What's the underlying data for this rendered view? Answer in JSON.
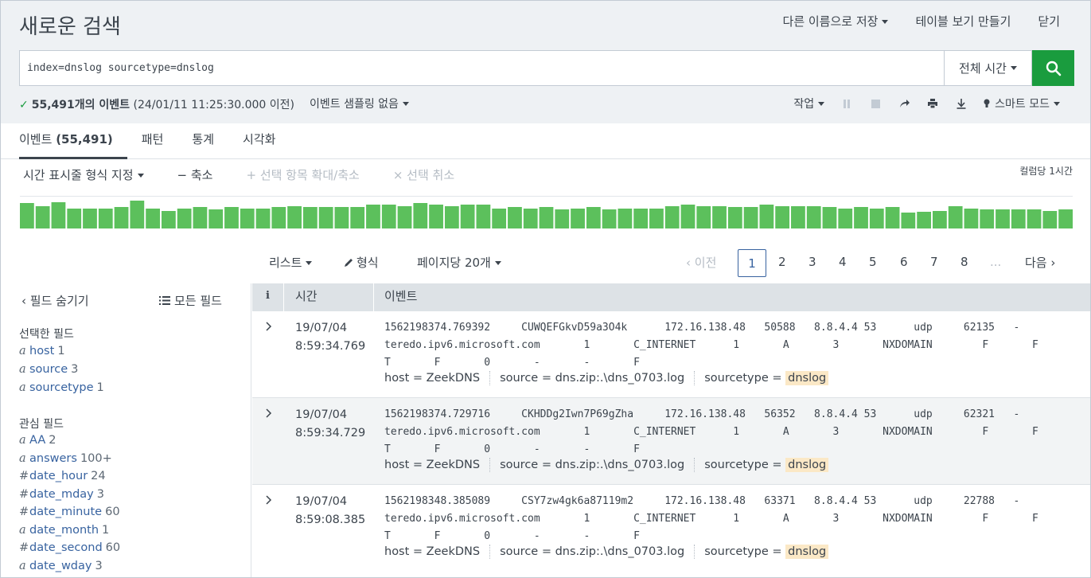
{
  "header": {
    "title": "새로운 검색",
    "save_as": "다른 이름으로 저장",
    "make_table": "테이블 보기 만들기",
    "close": "닫기"
  },
  "search": {
    "query": "index=dnslog sourcetype=dnslog",
    "time_range": "전체 시간"
  },
  "status": {
    "count_text": "55,491개의 이벤트",
    "time_text": "(24/01/11 11:25:30.000 이전)",
    "sampling": "이벤트 샘플링 없음",
    "job": "작업",
    "mode": "스마트 모드"
  },
  "tabs": [
    {
      "label": "이벤트",
      "count": "(55,491)"
    },
    {
      "label": "패턴"
    },
    {
      "label": "통계"
    },
    {
      "label": "시각화"
    }
  ],
  "timeline_tools": {
    "format": "시간 표시줄 형식 지정",
    "zoom_out": "축소",
    "zoom_sel": "선택 항목 확대/축소",
    "deselect": "선택 취소",
    "per_column": "컬럼당 1시간"
  },
  "timeline_bars": [
    32,
    28,
    33,
    25,
    25,
    25,
    27,
    35,
    25,
    22,
    25,
    27,
    24,
    27,
    25,
    25,
    27,
    28,
    27,
    27,
    27,
    27,
    30,
    30,
    28,
    32,
    30,
    28,
    30,
    30,
    25,
    27,
    25,
    27,
    24,
    25,
    27,
    24,
    25,
    25,
    25,
    28,
    30,
    28,
    28,
    27,
    27,
    30,
    28,
    28,
    28,
    27,
    25,
    27,
    25,
    27,
    20,
    21,
    22,
    28,
    25,
    24,
    24,
    24,
    24,
    22,
    24
  ],
  "paging": {
    "list": "리스트",
    "format": "형식",
    "per_page": "페이지당 20개",
    "prev": "이전",
    "pages": [
      "1",
      "2",
      "3",
      "4",
      "5",
      "6",
      "7",
      "8",
      "..."
    ],
    "next": "다음"
  },
  "sidebar": {
    "hide_fields": "필드 숨기기",
    "all_fields": "모든 필드",
    "selected_label": "선택한 필드",
    "selected": [
      {
        "type": "a",
        "name": "host",
        "count": "1"
      },
      {
        "type": "a",
        "name": "source",
        "count": "3"
      },
      {
        "type": "a",
        "name": "sourcetype",
        "count": "1"
      }
    ],
    "interesting_label": "관심 필드",
    "interesting": [
      {
        "type": "a",
        "name": "AA",
        "count": "2"
      },
      {
        "type": "a",
        "name": "answers",
        "count": "100+"
      },
      {
        "type": "#",
        "name": "date_hour",
        "count": "24"
      },
      {
        "type": "#",
        "name": "date_mday",
        "count": "3"
      },
      {
        "type": "#",
        "name": "date_minute",
        "count": "60"
      },
      {
        "type": "a",
        "name": "date_month",
        "count": "1"
      },
      {
        "type": "#",
        "name": "date_second",
        "count": "60"
      },
      {
        "type": "a",
        "name": "date_wday",
        "count": "3"
      }
    ]
  },
  "table": {
    "col_info": "i",
    "col_time": "시간",
    "col_event": "이벤트",
    "events": [
      {
        "date": "19/07/04",
        "time": "8:59:34.769",
        "line1": "1562198374.769392     CUWQEFGkvD59a3O4k      172.16.138.48   50588   8.8.4.4 53      udp     62135   -",
        "line2": "teredo.ipv6.microsoft.com       1       C_INTERNET      1       A       3       NXDOMAIN        F       F",
        "line3": "T       F       0       -       -       F",
        "host": "ZeekDNS",
        "source": "dns.zip:.\\dns_0703.log",
        "sourcetype": "dnslog"
      },
      {
        "date": "19/07/04",
        "time": "8:59:34.729",
        "line1": "1562198374.729716     CKHDDg2Iwn7P69gZha     172.16.138.48   56352   8.8.4.4 53      udp     62321   -",
        "line2": "teredo.ipv6.microsoft.com       1       C_INTERNET      1       A       3       NXDOMAIN        F       F",
        "line3": "T       F       0       -       -       F",
        "host": "ZeekDNS",
        "source": "dns.zip:.\\dns_0703.log",
        "sourcetype": "dnslog"
      },
      {
        "date": "19/07/04",
        "time": "8:59:08.385",
        "line1": "1562198348.385089     CSY7zw4gk6a87119m2     172.16.138.48   63371   8.8.4.4 53      udp     22788   -",
        "line2": "teredo.ipv6.microsoft.com       1       C_INTERNET      1       A       3       NXDOMAIN        F       F",
        "line3": "T       F       0       -       -       F",
        "host": "ZeekDNS",
        "source": "dns.zip:.\\dns_0703.log",
        "sourcetype": "dnslog"
      }
    ]
  },
  "meta_labels": {
    "host": "host =",
    "source": "source =",
    "sourcetype": "sourcetype ="
  },
  "colors": {
    "accent": "#1a9c3e",
    "link": "#3863a0",
    "bar": "#5cc05c"
  }
}
